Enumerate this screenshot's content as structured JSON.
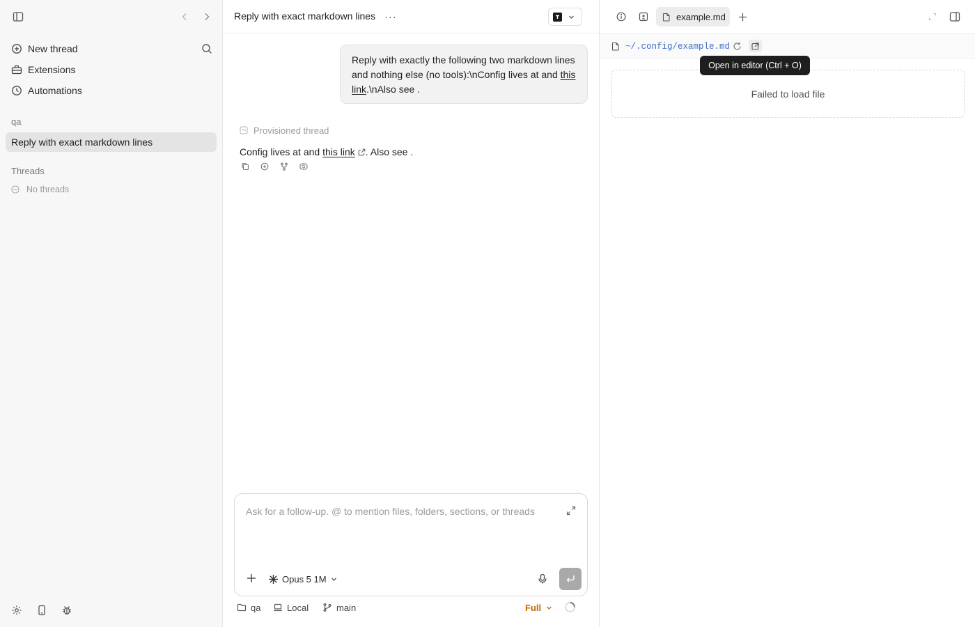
{
  "sidebar": {
    "nav": [
      {
        "label": "New thread",
        "icon": "plus-circle-icon"
      },
      {
        "label": "Extensions",
        "icon": "extensions-icon"
      },
      {
        "label": "Automations",
        "icon": "clock-icon"
      }
    ],
    "project_label": "qa",
    "active_thread": "Reply with exact markdown lines",
    "threads_label": "Threads",
    "empty_label": "No threads"
  },
  "header": {
    "title": "Reply with exact markdown lines",
    "more_label": "···"
  },
  "conversation": {
    "user_message": {
      "before_link": "Reply with exactly the following two markdown lines and nothing else (no tools):\\nConfig lives at and ",
      "link_text": "this link",
      "after_link": ".\\nAlso see ."
    },
    "provisioned_label": "Provisioned thread",
    "assistant_message": {
      "before_link": "Config lives at and ",
      "link_text": "this link",
      "after_link": ". Also see ."
    }
  },
  "composer": {
    "placeholder": "Ask for a follow-up. @ to mention files, folders, sections, or threads",
    "value": "",
    "model": "Opus 5 1M"
  },
  "status_bar": {
    "folder": "qa",
    "environment": "Local",
    "branch": "main",
    "access": "Full"
  },
  "right_panel": {
    "tab_label": "example.md",
    "path": "~/.config/example.md",
    "tooltip": "Open in editor (Ctrl + O)",
    "error": "Failed to load file"
  },
  "colors": {
    "access_accent": "#c26a00",
    "path_link": "#3a6ec4",
    "send_button": "#a9a9a9",
    "tooltip_bg": "#1e1e1e"
  }
}
